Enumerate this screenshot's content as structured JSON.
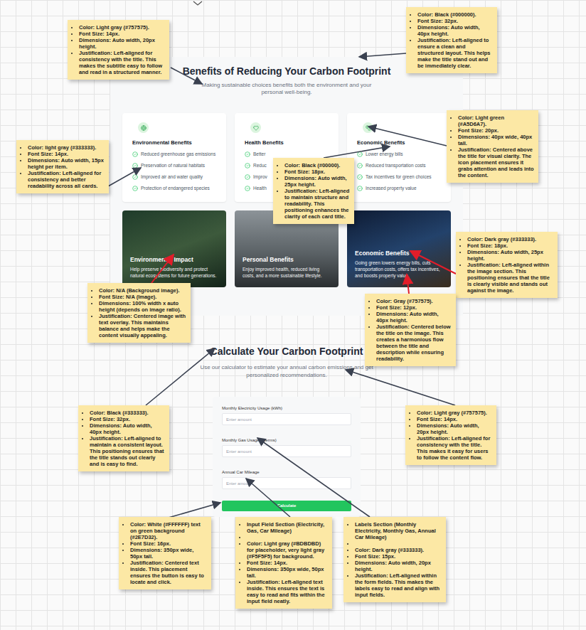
{
  "benefits": {
    "title": "Benefits of Reducing Your Carbon Footprint",
    "subtitle": "Making sustainable choices benefits both the environment and your personal well-being.",
    "cards": [
      {
        "title": "Environmental Benefits",
        "items": [
          "Reduced greenhouse gas emissions",
          "Preservation of natural habitats",
          "Improved air and water quality",
          "Protection of endangered species"
        ]
      },
      {
        "title": "Health Benefits",
        "items": [
          "Better",
          "Reduc",
          "Improv",
          "Health"
        ]
      },
      {
        "title": "Economic Benefits",
        "items": [
          "Lower energy bills",
          "Reduced transportation costs",
          "Tax incentives for green choices",
          "Increased property value"
        ]
      }
    ],
    "image_cards": [
      {
        "title": "Environmental Impact",
        "description": "Help preserve biodiversity and protect natural ecosystems for future generations."
      },
      {
        "title": "Personal Benefits",
        "description": "Enjoy improved health, reduced living costs, and a more sustainable lifestyle."
      },
      {
        "title": "Economic Benefits",
        "description": "Going green lowers energy bills, cuts transportation costs, offers tax incentives, and boosts property value."
      }
    ]
  },
  "calculator": {
    "title": "Calculate Your Carbon Footprint",
    "subtitle": "Use our calculator to estimate your annual carbon emissions and get personalized recommendations.",
    "fields": [
      {
        "label": "Monthly Electricity Usage (kWh)",
        "placeholder": "Enter amount"
      },
      {
        "label": "Monthly Gas Usage (therms)",
        "placeholder": "Enter amount"
      },
      {
        "label": "Annual Car Mileage",
        "placeholder": "Enter amount"
      }
    ],
    "button": "Calculate"
  },
  "notes": [
    {
      "items": [
        {
          "kind": "field",
          "label": "Color:",
          "text": "Light gray (#757575)."
        },
        {
          "kind": "field",
          "label": "Font Size:",
          "text": "14px."
        },
        {
          "kind": "field",
          "label": "Dimensions:",
          "text": "Auto width, 20px height."
        },
        {
          "kind": "field",
          "label": "Justification:",
          "text": "Left-aligned for consistency with the title. This makes the subtitle easy to follow and read in a structured manner."
        }
      ]
    },
    {
      "items": [
        {
          "kind": "field",
          "label": "Color:",
          "text": "Black (#000000)."
        },
        {
          "kind": "field",
          "label": "Font Size:",
          "text": "32px."
        },
        {
          "kind": "field",
          "label": "Dimensions:",
          "text": "Auto width, 40px height."
        },
        {
          "kind": "field",
          "label": "Justification:",
          "text": "Left-aligned to ensure a clean and structured layout. This helps make the title stand out and be immediately clear."
        }
      ]
    },
    {
      "items": [
        {
          "kind": "field",
          "label": "Color:",
          "text": "Light green (#A5D6A7)."
        },
        {
          "kind": "field",
          "label": "Font Size:",
          "text": "20px."
        },
        {
          "kind": "field",
          "label": "Dimensions:",
          "text": "40px wide, 40px tall."
        },
        {
          "kind": "field",
          "label": "Justification:",
          "text": "Centered above the title for visual clarity. The icon placement ensures it grabs attention and leads into the content."
        }
      ]
    },
    {
      "items": [
        {
          "kind": "field",
          "label": "Color:",
          "text": "light gray (#333333)."
        },
        {
          "kind": "field",
          "label": "Font Size:",
          "text": "14px."
        },
        {
          "kind": "field",
          "label": "Dimensions:",
          "text": "Auto width, 15px height per item."
        },
        {
          "kind": "field",
          "label": "Justification:",
          "text": "Left-aligned for consistency and better readability across all cards."
        }
      ]
    },
    {
      "items": [
        {
          "kind": "field",
          "label": "Color:",
          "text": "Black  (#00000)."
        },
        {
          "kind": "field",
          "label": "Font Size:",
          "text": "18px."
        },
        {
          "kind": "field",
          "label": "Dimensions:",
          "text": "Auto width, 25px height."
        },
        {
          "kind": "field",
          "label": "Justification:",
          "text": "Left-aligned to maintain structure and readability. This positioning enhances the clarity of each card title."
        }
      ]
    },
    {
      "items": [
        {
          "kind": "field",
          "label": "Color:",
          "text": "Dark gray (#333333)."
        },
        {
          "kind": "field",
          "label": "Font Size:",
          "text": "18px."
        },
        {
          "kind": "field",
          "label": "Dimensions:",
          "text": "Auto width, 25px height."
        },
        {
          "kind": "field",
          "label": "Justification:",
          "text": "Left-aligned within the image section. This positioning ensures that the title is clearly visible and stands out against the image."
        }
      ]
    },
    {
      "items": [
        {
          "kind": "field",
          "label": "Color:",
          "text": "N/A (Background image)."
        },
        {
          "kind": "field",
          "label": "Font Size:",
          "text": "N/A (Image)."
        },
        {
          "kind": "field",
          "label": "Dimensions:",
          "text": "100% width x auto height (depends on image ratio)."
        },
        {
          "kind": "field",
          "label": "Justification:",
          "text": "Centered image with text overlay. This maintains balance and helps make the content visually appealing."
        }
      ]
    },
    {
      "items": [
        {
          "kind": "field",
          "label": "Color:",
          "text": "Gray (#757575)."
        },
        {
          "kind": "field",
          "label": "Font Size:",
          "text": "12px."
        },
        {
          "kind": "field",
          "label": "Dimensions:",
          "text": "Auto width, 40px height."
        },
        {
          "kind": "field",
          "label": "Justification:",
          "text": "Centered below the title on the image. This creates a harmonious flow between the title and description while ensuring readability."
        }
      ]
    },
    {
      "items": [
        {
          "kind": "field",
          "label": "Color:",
          "text": "Black (#333333)."
        },
        {
          "kind": "field",
          "label": "Font Size:",
          "text": "32px."
        },
        {
          "kind": "field",
          "label": "Dimensions:",
          "text": "Auto width, 40px height."
        },
        {
          "kind": "field",
          "label": "Justification:",
          "text": "Left-aligned to maintain a consistent layout. This positioning ensures that the title stands out clearly and is easy to find."
        }
      ]
    },
    {
      "items": [
        {
          "kind": "field",
          "label": "Color:",
          "text": "Light gray (#757575)."
        },
        {
          "kind": "field",
          "label": "Font Size:",
          "text": "14px."
        },
        {
          "kind": "field",
          "label": "Dimensions:",
          "text": "Auto width, 20px height."
        },
        {
          "kind": "field",
          "label": "Justification:",
          "text": "Left-aligned for consistency with the title. This makes it easy for users to follow the content flow."
        }
      ]
    },
    {
      "items": [
        {
          "kind": "field",
          "label": "Color:",
          "text": "White (#FFFFFF) text on green background (#2E7D32)."
        },
        {
          "kind": "field",
          "label": "Font Size:",
          "text": "16px."
        },
        {
          "kind": "field",
          "label": "Dimensions:",
          "text": "350px wide, 50px tall."
        },
        {
          "kind": "field",
          "label": "Justification:",
          "text": "Centered text inside. This placement ensures the button is easy to locate and click."
        }
      ]
    },
    {
      "items": [
        {
          "kind": "heading",
          "label": "",
          "text": "Input Field Section (Electricity, Gas, Car Mileage)"
        },
        {
          "kind": "blank",
          "label": "",
          "text": ""
        },
        {
          "kind": "field",
          "label": "Color:",
          "text": "Light gray (#BDBDBD) for placeholder, very light gray (#F5F5F5) for background."
        },
        {
          "kind": "field",
          "label": "Font Size:",
          "text": "14px."
        },
        {
          "kind": "field",
          "label": "Dimensions:",
          "text": "350px wide, 50px tall."
        },
        {
          "kind": "field",
          "label": "Justification:",
          "text": "Left-aligned text inside. This ensures the text is easy to read and fits within the input field neatly."
        }
      ]
    },
    {
      "items": [
        {
          "kind": "heading",
          "label": "",
          "text": "Labels Section (Monthly Electricity, Monthly Gas, Annual Car Mileage)"
        },
        {
          "kind": "blank",
          "label": "",
          "text": ""
        },
        {
          "kind": "field",
          "label": "Color:",
          "text": "Dark gray (#333333)."
        },
        {
          "kind": "field",
          "label": "Font Size:",
          "text": "15px."
        },
        {
          "kind": "field",
          "label": "Dimensions:",
          "text": "Auto width, 20px height."
        },
        {
          "kind": "field",
          "label": "Justification:",
          "text": "Left-aligned within the form fields. This makes the labels easy to read and align with input fields."
        }
      ]
    }
  ]
}
